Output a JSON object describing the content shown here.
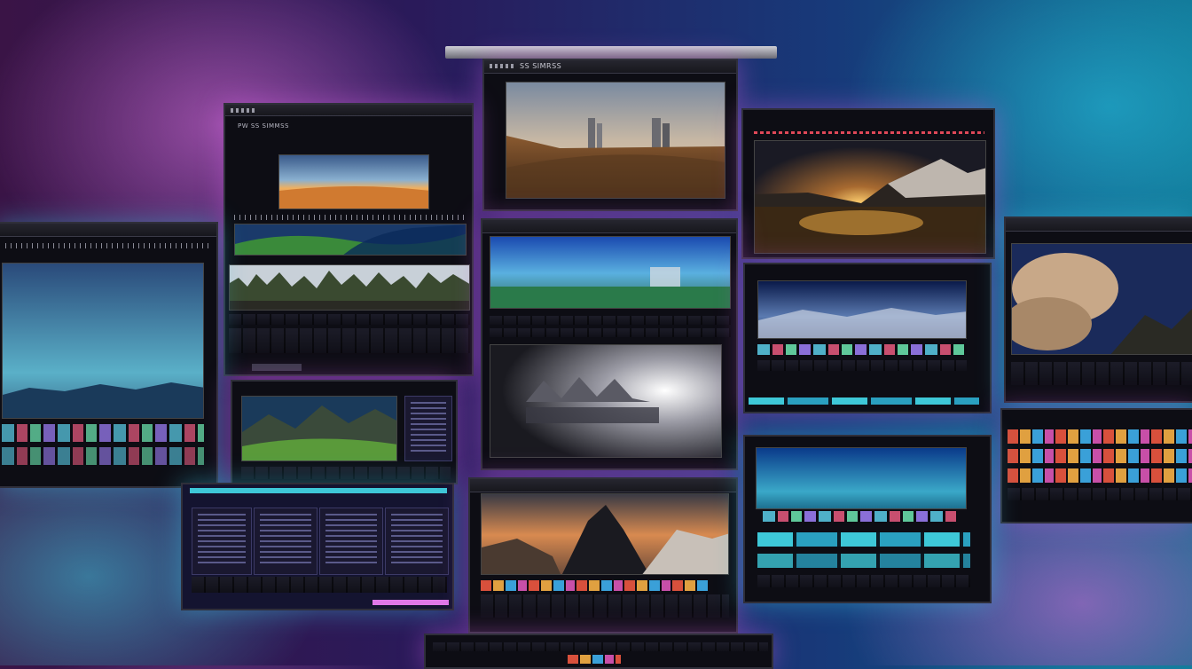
{
  "scene": {
    "windows": [
      {
        "id": "top-center",
        "title": "SS SIMRSS"
      },
      {
        "id": "upper-left",
        "title": "PW SS SIMMSS"
      },
      {
        "id": "upper-right",
        "title": ""
      },
      {
        "id": "far-left",
        "title": ""
      },
      {
        "id": "center-middle",
        "title": ""
      },
      {
        "id": "right-middle",
        "title": ""
      },
      {
        "id": "far-right",
        "title": ""
      },
      {
        "id": "lower-left",
        "title": ""
      },
      {
        "id": "lower-center",
        "title": ""
      },
      {
        "id": "lower-right",
        "title": ""
      }
    ],
    "colors": {
      "glow_magenta": "#e078e8",
      "glow_cyan": "#3cc8e6",
      "background": "#2a1a5a"
    }
  }
}
